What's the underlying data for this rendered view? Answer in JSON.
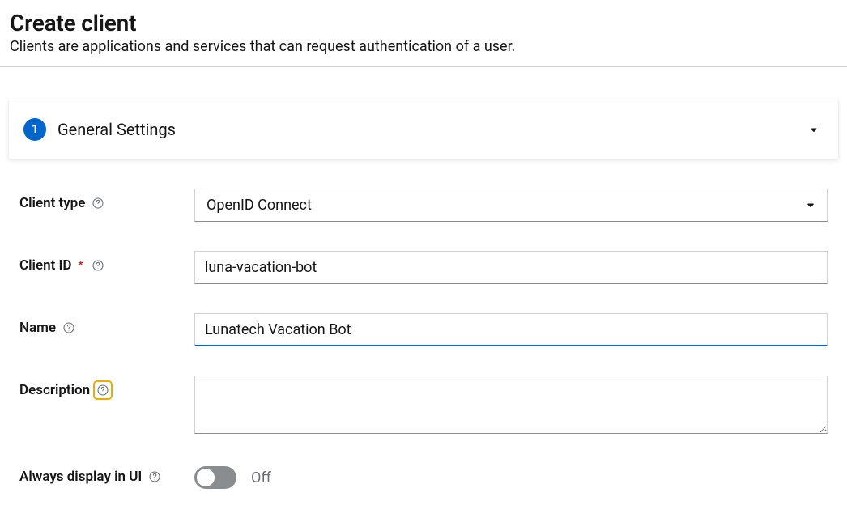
{
  "header": {
    "title": "Create client",
    "subtitle": "Clients are applications and services that can request authentication of a user."
  },
  "wizard": {
    "step_number": "1",
    "step_title": "General Settings"
  },
  "form": {
    "client_type": {
      "label": "Client type",
      "value": "OpenID Connect"
    },
    "client_id": {
      "label": "Client ID",
      "value": "luna-vacation-bot"
    },
    "name": {
      "label": "Name",
      "value": "Lunatech Vacation Bot"
    },
    "description": {
      "label": "Description",
      "value": ""
    },
    "always_display": {
      "label": "Always display in UI",
      "state_label": "Off"
    }
  }
}
